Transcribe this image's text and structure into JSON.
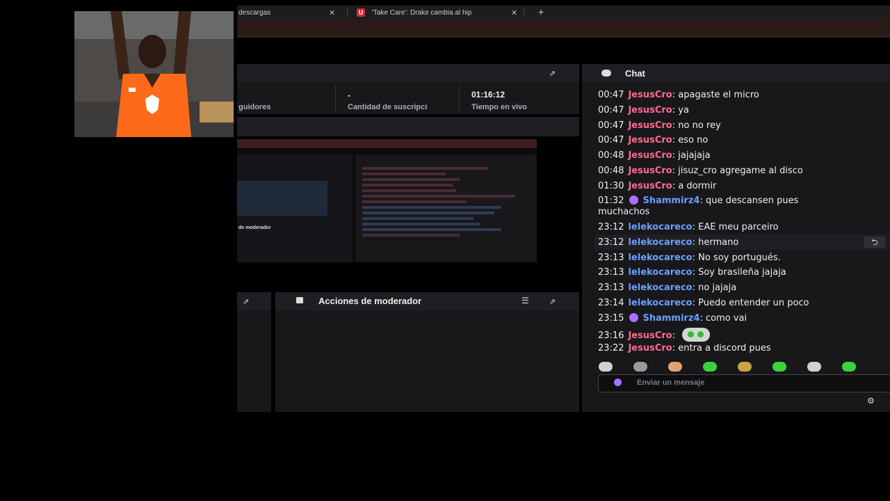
{
  "browser": {
    "tabs": [
      {
        "title": "descargas"
      },
      {
        "title": "'Take Care': Drake cambia al hip"
      }
    ],
    "new_tab_label": "+"
  },
  "stats": {
    "followers_label": "guidores",
    "subs_value": "-",
    "subs_label": "Cantidad de suscripciones",
    "live_time_value": "01:16:12",
    "live_time_label": "Tiempo en vivo"
  },
  "mod_panel": {
    "title": "Acciones de moderador",
    "preview_title": "de moderador"
  },
  "chat": {
    "title": "Chat",
    "input_placeholder": "Enviar un mensaje",
    "messages": [
      {
        "time": "00:47",
        "user": "JesusCro",
        "text": ": apagaste el micro"
      },
      {
        "time": "00:47",
        "user": "JesusCro",
        "text": ": ya"
      },
      {
        "time": "00:47",
        "user": "JesusCro",
        "text": ": no no rey"
      },
      {
        "time": "00:47",
        "user": "JesusCro",
        "text": ": eso no"
      },
      {
        "time": "00:48",
        "user": "JesusCro",
        "text": ": jajajaja"
      },
      {
        "time": "00:48",
        "user": "JesusCro",
        "text": ": jisuz_cro agregame al disco"
      },
      {
        "time": "01:30",
        "user": "JesusCro",
        "text": ": a dormir"
      },
      {
        "time": "01:32",
        "user": "Shammirz4",
        "text": ": que descansen pues",
        "text2": "muchachos"
      },
      {
        "time": "23:12",
        "user": "lelekocareco",
        "text": ": EAE meu parceiro"
      },
      {
        "time": "23:12",
        "user": "lelekocareco",
        "text": ": hermano"
      },
      {
        "time": "23:13",
        "user": "lelekocareco",
        "text": ": No soy portugués."
      },
      {
        "time": "23:13",
        "user": "lelekocareco",
        "text": ": Soy brasileña jajaja"
      },
      {
        "time": "23:13",
        "user": "lelekocareco",
        "text": ": no jajaja"
      },
      {
        "time": "23:14",
        "user": "lelekocareco",
        "text": ": Puedo entender un poco"
      },
      {
        "time": "23:15",
        "user": "Shammirz4",
        "text": ": como vai"
      },
      {
        "time": "23:16",
        "user": "JesusCro",
        "text": ":"
      },
      {
        "time": "23:22",
        "user": "JesusCro",
        "text": ": entra a discord pues"
      }
    ]
  },
  "colors": {
    "user_pink": "#ff6b8b",
    "user_blue": "#6c9fff",
    "badge_purple": "#a970ff",
    "panel_bg": "#18181b"
  },
  "icons": [
    "popout-icon",
    "chat-bubble-icon",
    "filter-icon",
    "settings-icon",
    "reply-icon",
    "close-icon"
  ]
}
